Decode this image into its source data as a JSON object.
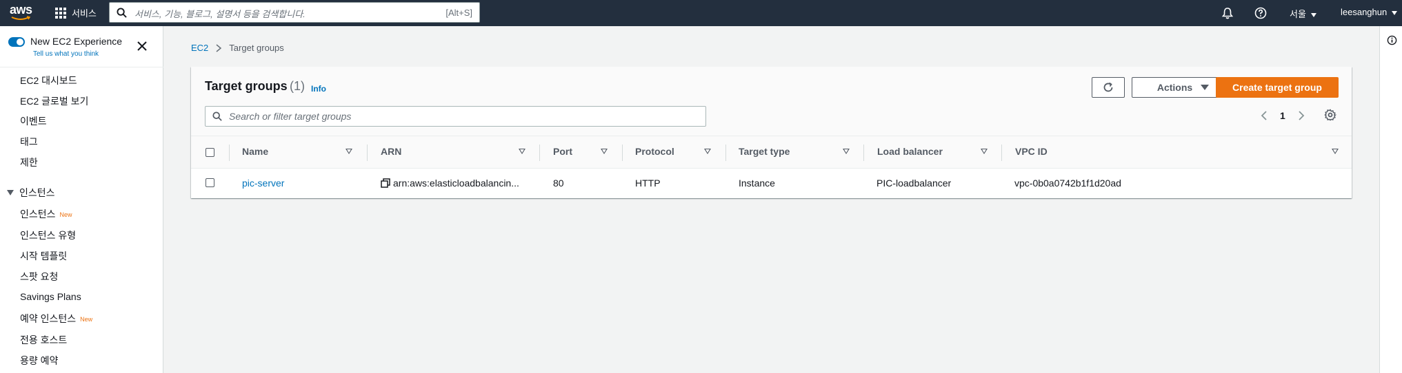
{
  "topnav": {
    "logo_text": "aws",
    "services_label": "서비스",
    "search_placeholder": "서비스, 기능, 블로그, 설명서 등을 검색합니다.",
    "search_shortcut": "[Alt+S]",
    "region": "서울",
    "user": "leesanghun"
  },
  "sidebar": {
    "experience_title": "New EC2 Experience",
    "experience_link": "Tell us what you think",
    "top_items": [
      "EC2 대시보드",
      "EC2 글로벌 보기",
      "이벤트",
      "태그",
      "제한"
    ],
    "section_title": "인스턴스",
    "section_items": [
      {
        "label": "인스턴스",
        "badge": "New"
      },
      {
        "label": "인스턴스 유형",
        "badge": ""
      },
      {
        "label": "시작 템플릿",
        "badge": ""
      },
      {
        "label": "스팟 요청",
        "badge": ""
      },
      {
        "label": "Savings Plans",
        "badge": ""
      },
      {
        "label": "예약 인스턴스",
        "badge": "New"
      },
      {
        "label": "전용 호스트",
        "badge": ""
      },
      {
        "label": "용량 예약",
        "badge": ""
      }
    ]
  },
  "breadcrumb": {
    "root": "EC2",
    "current": "Target groups"
  },
  "panel": {
    "title": "Target groups",
    "count": "(1)",
    "info": "Info",
    "actions_label": "Actions",
    "create_label": "Create target group",
    "filter_placeholder": "Search or filter target groups",
    "page": "1"
  },
  "table": {
    "columns": [
      "Name",
      "ARN",
      "Port",
      "Protocol",
      "Target type",
      "Load balancer",
      "VPC ID"
    ],
    "rows": [
      {
        "name": "pic-server",
        "arn": "arn:aws:elasticloadbalancin...",
        "port": "80",
        "protocol": "HTTP",
        "target_type": "Instance",
        "load_balancer": "PIC-loadbalancer",
        "vpc_id": "vpc-0b0a0742b1f1d20ad"
      }
    ]
  },
  "colors": {
    "nav_bg": "#232f3e",
    "accent_orange": "#ec7211",
    "link_blue": "#0073bb"
  }
}
